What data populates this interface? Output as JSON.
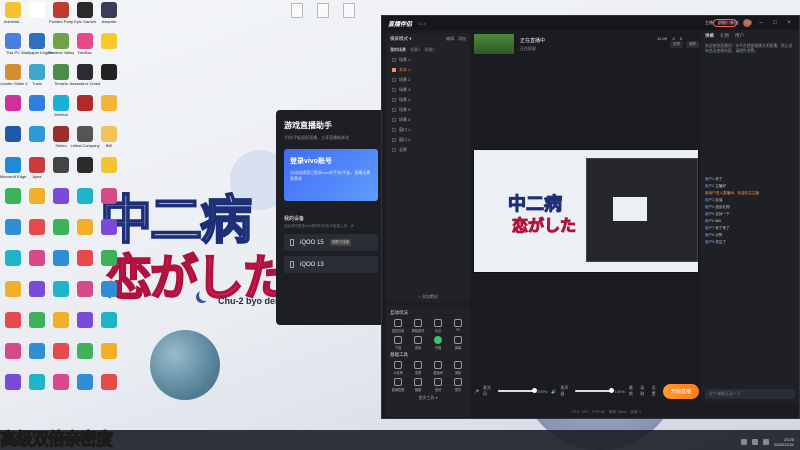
{
  "wallpaper": {
    "title_line1": "中二病",
    "title_line2": "恋がした",
    "subtitle": "Chu-2 byo dem"
  },
  "desktop_icons": [
    {
      "label": "Administ...",
      "color": "#f4c430"
    },
    {
      "label": "",
      "color": "#ffffff"
    },
    {
      "label": "Painted Party",
      "color": "#c13a2f"
    },
    {
      "label": "Epic Games",
      "color": "#2a2a2a"
    },
    {
      "label": "Aseprite",
      "color": "#3a3d5a"
    },
    {
      "label": "This PC",
      "color": "#4a7ee0"
    },
    {
      "label": "Wallpaper Engine",
      "color": "#2f6fbf"
    },
    {
      "label": "Stardew Valley",
      "color": "#6fa34a"
    },
    {
      "label": "DevBox",
      "color": "#e64a8a"
    },
    {
      "label": "",
      "color": "#f7c92b"
    },
    {
      "label": "Counter-Strike 2",
      "color": "#d09030"
    },
    {
      "label": "Tunic",
      "color": "#3ea6c9"
    },
    {
      "label": "Terraria",
      "color": "#4c8b4c"
    },
    {
      "label": "Assassin's Creed",
      "color": "#2b2b33"
    },
    {
      "label": "",
      "color": "#222"
    },
    {
      "label": "",
      "color": "#d0309d"
    },
    {
      "label": "",
      "color": "#2f7fe0"
    },
    {
      "label": "WeMod",
      "color": "#1ab0d8"
    },
    {
      "label": "",
      "color": "#b02a2a"
    },
    {
      "label": "",
      "color": "#f4b43a"
    },
    {
      "label": "",
      "color": "#1e5aa8"
    },
    {
      "label": "",
      "color": "#2e9bd6"
    },
    {
      "label": "Sekiro",
      "color": "#9a2d2d"
    },
    {
      "label": "Lethal Company",
      "color": "#555"
    },
    {
      "label": "BW",
      "color": "#f0c35a"
    },
    {
      "label": "Microsoft Edge",
      "color": "#1e8ad8"
    },
    {
      "label": "Apex",
      "color": "#cc3b3b"
    },
    {
      "label": "",
      "color": "#444"
    },
    {
      "label": "",
      "color": "#2b2b2b"
    },
    {
      "label": "",
      "color": "#f4c430"
    }
  ],
  "vivo_panel": {
    "title": "游戏直播助手",
    "desc": "手机/平板投屏直播，立享直播新体验",
    "login_title": "登录vivo账号",
    "login_desc": "自动连接您已登录vivo的手机/平板，直播无需要登录",
    "devices_title": "我的设备",
    "devices_desc": "然后请勿登录vivo账号的手机/平板直入其…W",
    "devices": [
      {
        "name": "iQOO 15",
        "badge": "投屏已连接"
      },
      {
        "name": "iQOO 13",
        "badge": ""
      }
    ]
  },
  "app": {
    "logo": "直播伴侣",
    "version": "V1.0",
    "live_badge": "立即直播",
    "username": "主播",
    "scene_mode": "横屏模式 ▾",
    "scene_actions": [
      "编辑",
      "添加"
    ],
    "scene_tabs": [
      "我的场景",
      "场景1",
      "场景2"
    ],
    "scenes": [
      {
        "label": "场景 1",
        "selected": false
      },
      {
        "label": "文本 1",
        "selected": true
      },
      {
        "label": "场景 2",
        "selected": false
      },
      {
        "label": "场景 3",
        "selected": false
      },
      {
        "label": "场景 4",
        "selected": false
      },
      {
        "label": "场景 5",
        "selected": false
      },
      {
        "label": "场景 6",
        "selected": false
      },
      {
        "label": "窗口 1",
        "selected": false
      },
      {
        "label": "窗口 2",
        "selected": false
      },
      {
        "label": "全屏",
        "selected": false
      }
    ],
    "add_source": "+ 添加素材",
    "preview_title": "正在直播中",
    "preview_subtitle": "正在投屏",
    "preview_chips": [
      "投屏",
      "横屏"
    ],
    "preview_stats": [
      "12.0K",
      "0",
      "0"
    ],
    "tools_title": "互动玩法",
    "tools": [
      {
        "label": "语音连麦",
        "on": false
      },
      {
        "label": "屏幕推流",
        "on": false
      },
      {
        "label": "玩法",
        "on": false
      },
      {
        "label": "PK",
        "on": false
      },
      {
        "label": "下载",
        "on": false
      },
      {
        "label": "音量",
        "on": false
      },
      {
        "label": "开播",
        "on": true
      },
      {
        "label": "弹幕",
        "on": false
      }
    ],
    "basic_tools_title": "基础工具",
    "basic_tools": [
      {
        "label": "公告牌",
        "on": false
      },
      {
        "label": "录屏",
        "on": false
      },
      {
        "label": "直播间",
        "on": false
      },
      {
        "label": "美颜",
        "on": false
      },
      {
        "label": "直播数据",
        "on": false
      },
      {
        "label": "截图",
        "on": false
      },
      {
        "label": "音效",
        "on": false
      },
      {
        "label": "更多",
        "on": false
      }
    ],
    "more_tools": "更多工具 ▾",
    "mic_label": "麦克风",
    "mic_value": "100%",
    "speaker_label": "扬声器",
    "speaker_value": "100%",
    "right_buttons": [
      "美颜",
      "录制",
      "设置"
    ],
    "start_live": "开始直播",
    "status_bar": [
      "CPU: 12%",
      "FPS: 60",
      "码率: 0kb/s",
      "丢帧: 0"
    ]
  },
  "top_nav": [
    "主播",
    "消息",
    "粉丝",
    "直播"
  ],
  "chat": {
    "tabs": [
      "弹幕",
      "礼物",
      "用户"
    ],
    "notice": "欢迎来到直播间！本平台提倡健康文明直播，禁止发布违法违规内容，请理性消费。",
    "messages": [
      {
        "name": "用户1",
        "text": "来了",
        "sys": false
      },
      {
        "name": "用户2",
        "text": "主播好",
        "sys": false
      },
      {
        "name": "",
        "text": "新用户进入直播间，欢迎关注主播",
        "sys": true
      },
      {
        "name": "用户3",
        "text": "加油",
        "sys": false
      },
      {
        "name": "用户4",
        "text": "送出礼物",
        "sys": false
      },
      {
        "name": "用户5",
        "text": "支持一下",
        "sys": false
      },
      {
        "name": "用户6",
        "text": "666",
        "sys": false
      },
      {
        "name": "用户7",
        "text": "来了来了",
        "sys": false
      },
      {
        "name": "用户8",
        "text": "点赞",
        "sys": false
      },
      {
        "name": "用户9",
        "text": "关注了",
        "sys": false
      }
    ],
    "input_placeholder": "发个弹幕互动一下"
  },
  "taskbar": {
    "overlay_text": "高级双倍亲密度",
    "time": "23:25",
    "date": "2025/12/31"
  }
}
